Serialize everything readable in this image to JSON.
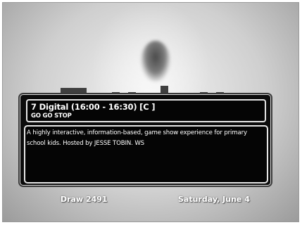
{
  "program": {
    "time_line": "7 Digital (16:00 - 16:30)   [C ]",
    "title": "GO GO STOP",
    "description": "A highly interactive, information-based, game show experience for primary school kids.  Hosted by JESSE TOBIN. WS"
  },
  "footer": {
    "draw": "Draw 2491",
    "date": "Saturday, June 4"
  }
}
